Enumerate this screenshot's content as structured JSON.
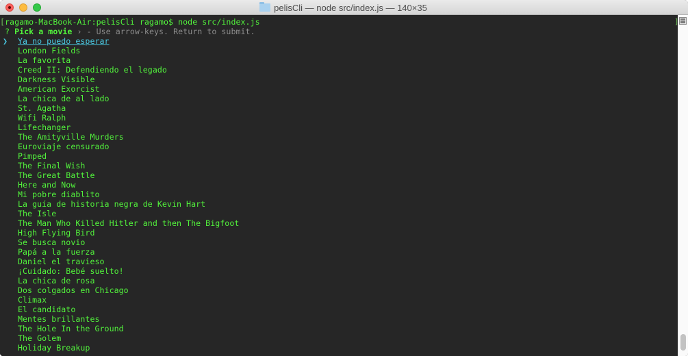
{
  "window": {
    "title": "pelisCli — node src/index.js — 140×35",
    "title_icon": "folder-icon",
    "controls": [
      "close",
      "minimize",
      "maximize"
    ]
  },
  "terminal": {
    "command_prompt": {
      "open_bracket": "[",
      "prompt": "ragamo-MacBook-Air:pelisCli ragamo$ ",
      "command": "node src/index.js",
      "close_bracket": "]"
    },
    "question": {
      "mark": "?",
      "label": "Pick a movie",
      "separator": "›",
      "hint": "- Use arrow-keys. Return to submit."
    },
    "pointer_glyph": "❯",
    "selected_index": 0,
    "options": [
      "Ya no puedo esperar",
      "London Fields",
      "La favorita",
      "Creed II: Defendiendo el legado",
      "Darkness Visible",
      "American Exorcist",
      "La chica de al lado",
      "St. Agatha",
      "Wifi Ralph",
      "Lifechanger",
      "The Amityville Murders",
      "Euroviaje censurado",
      "Pimped",
      "The Final Wish",
      "The Great Battle",
      "Here and Now",
      "Mi pobre diablito",
      "La guía de historia negra de Kevin Hart",
      "The Isle",
      "The Man Who Killed Hitler and then The Bigfoot",
      "High Flying Bird",
      "Se busca novio",
      "Papá a la fuerza",
      "Daniel el travieso",
      "¡Cuidado: Bebé suelto!",
      "La chica de rosa",
      "Dos colgados en Chicago",
      "Climax",
      "El candidato",
      "Mentes brillantes",
      "The Hole In the Ground",
      "The Golem",
      "Holiday Breakup"
    ]
  },
  "colors": {
    "terminal_bg": "#262626",
    "text_green": "#52f33c",
    "selected_cyan": "#4ac9e3",
    "hint_gray": "#8c8c8c"
  },
  "scrollbar": {
    "position_fraction": 1.0
  }
}
